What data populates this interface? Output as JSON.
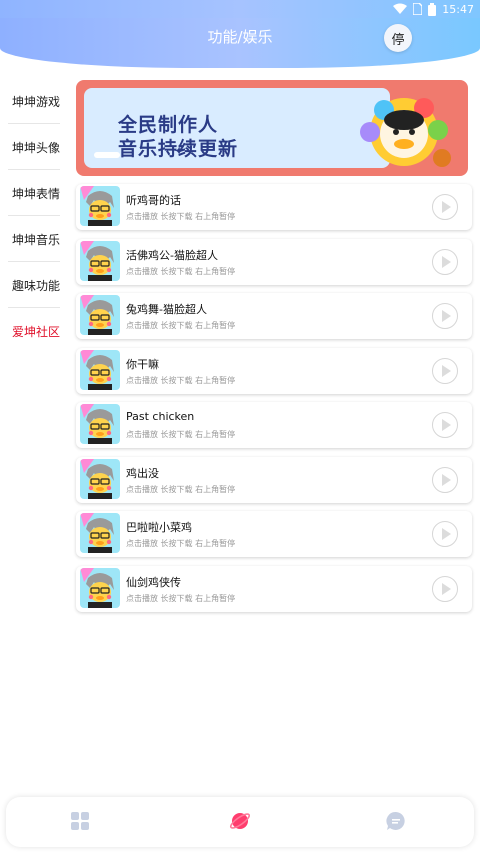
{
  "status_bar": {
    "time": "15:47",
    "icons": [
      "wifi-icon",
      "sim-icon",
      "battery-icon"
    ]
  },
  "header": {
    "title": "功能/娱乐",
    "stop_label": "停"
  },
  "sidebar": {
    "items": [
      {
        "label": "坤坤游戏"
      },
      {
        "label": "坤坤头像"
      },
      {
        "label": "坤坤表情"
      },
      {
        "label": "坤坤音乐"
      },
      {
        "label": "趣味功能"
      },
      {
        "label": "爱坤社区"
      }
    ]
  },
  "banner": {
    "line1": "全民制作人",
    "line2": "音乐持续更新"
  },
  "songs": [
    {
      "name": "听鸡哥的话",
      "hint": "点击播放 长按下载 右上角暂停"
    },
    {
      "name": "活佛鸡公-猫脸超人",
      "hint": "点击播放 长按下载 右上角暂停"
    },
    {
      "name": "兔鸡舞-猫脸超人",
      "hint": "点击播放 长按下载 右上角暂停"
    },
    {
      "name": "你干嘛",
      "hint": "点击播放 长按下载 右上角暂停"
    },
    {
      "name": " Past chicken",
      "hint": "点击播放 长按下载 右上角暂停"
    },
    {
      "name": "鸡出没",
      "hint": "点击播放 长按下载 右上角暂停"
    },
    {
      "name": "巴啦啦小菜鸡",
      "hint": "点击播放 长按下载 右上角暂停"
    },
    {
      "name": "仙剑鸡侠传",
      "hint": "点击播放 长按下载 右上角暂停"
    }
  ],
  "bottom_nav": {
    "tabs": [
      "grid-icon",
      "planet-icon",
      "chat-icon"
    ],
    "active": "planet-icon"
  },
  "colors": {
    "accent": "#8eb0ff",
    "active_sidebar": "#e0102a",
    "active_tab": "#ff3d6e",
    "inactive_tab": "#c7d0e2"
  }
}
